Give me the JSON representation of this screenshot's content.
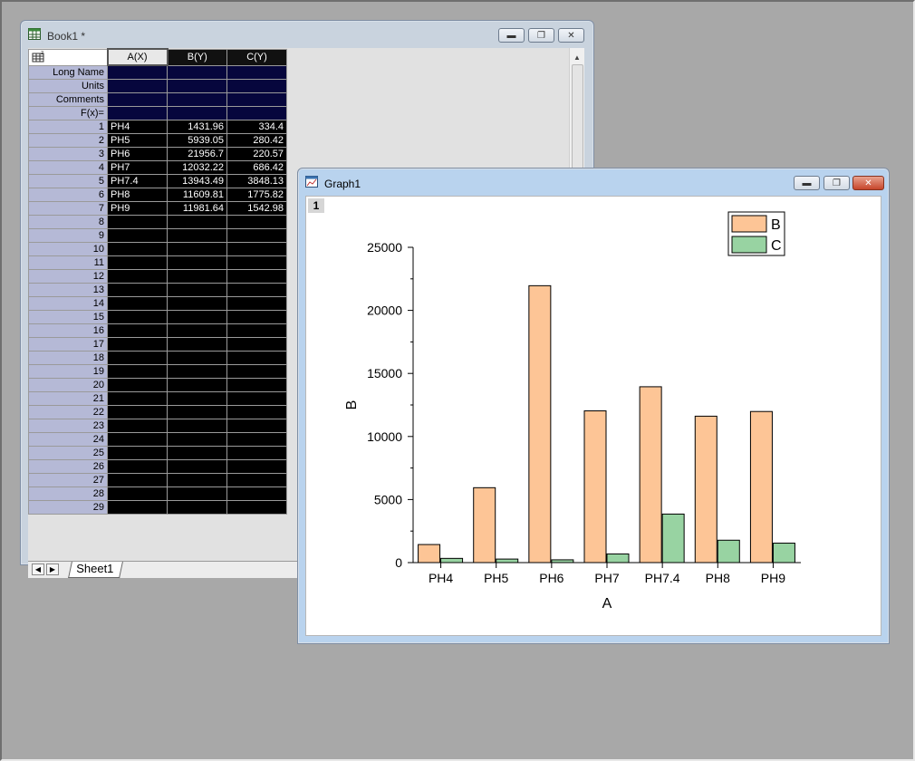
{
  "book": {
    "title": "Book1 *",
    "columns": [
      "A(X)",
      "B(Y)",
      "C(Y)"
    ],
    "meta_rows": [
      "Long Name",
      "Units",
      "Comments",
      "F(x)="
    ],
    "rows": [
      [
        "PH4",
        "1431.96",
        "334.4"
      ],
      [
        "PH5",
        "5939.05",
        "280.42"
      ],
      [
        "PH6",
        "21956.7",
        "220.57"
      ],
      [
        "PH7",
        "12032.22",
        "686.42"
      ],
      [
        "PH7.4",
        "13943.49",
        "3848.13"
      ],
      [
        "PH8",
        "11609.81",
        "1775.82"
      ],
      [
        "PH9",
        "11981.64",
        "1542.98"
      ]
    ],
    "row_numbers": [
      "1",
      "2",
      "3",
      "4",
      "5",
      "6",
      "7",
      "8",
      "9",
      "10",
      "11",
      "12",
      "13",
      "14",
      "15",
      "16",
      "17",
      "18",
      "19",
      "20",
      "21",
      "22",
      "23",
      "24",
      "25",
      "26",
      "27",
      "28",
      "29"
    ],
    "sheet_tab": "Sheet1"
  },
  "graph": {
    "title": "Graph1",
    "layer": "1"
  },
  "chart_data": {
    "type": "bar",
    "categories": [
      "PH4",
      "PH5",
      "PH6",
      "PH7",
      "PH7.4",
      "PH8",
      "PH9"
    ],
    "series": [
      {
        "name": "B",
        "values": [
          1431.96,
          5939.05,
          21956.7,
          12032.22,
          13943.49,
          11609.81,
          11981.64
        ],
        "color": "#fdc596"
      },
      {
        "name": "C",
        "values": [
          334.4,
          280.42,
          220.57,
          686.42,
          3848.13,
          1775.82,
          1542.98
        ],
        "color": "#98d3a2"
      }
    ],
    "xlabel": "A",
    "ylabel": "B",
    "ylim": [
      0,
      25000
    ],
    "yticks": [
      "0",
      "5000",
      "10000",
      "15000",
      "20000",
      "25000"
    ],
    "legend": "top-right",
    "grid": false
  },
  "colors": {
    "desktop": "#a8a8a8",
    "row_header": "#b5b9d6",
    "meta_cells": "#06063d",
    "data_cells": "#000000"
  }
}
